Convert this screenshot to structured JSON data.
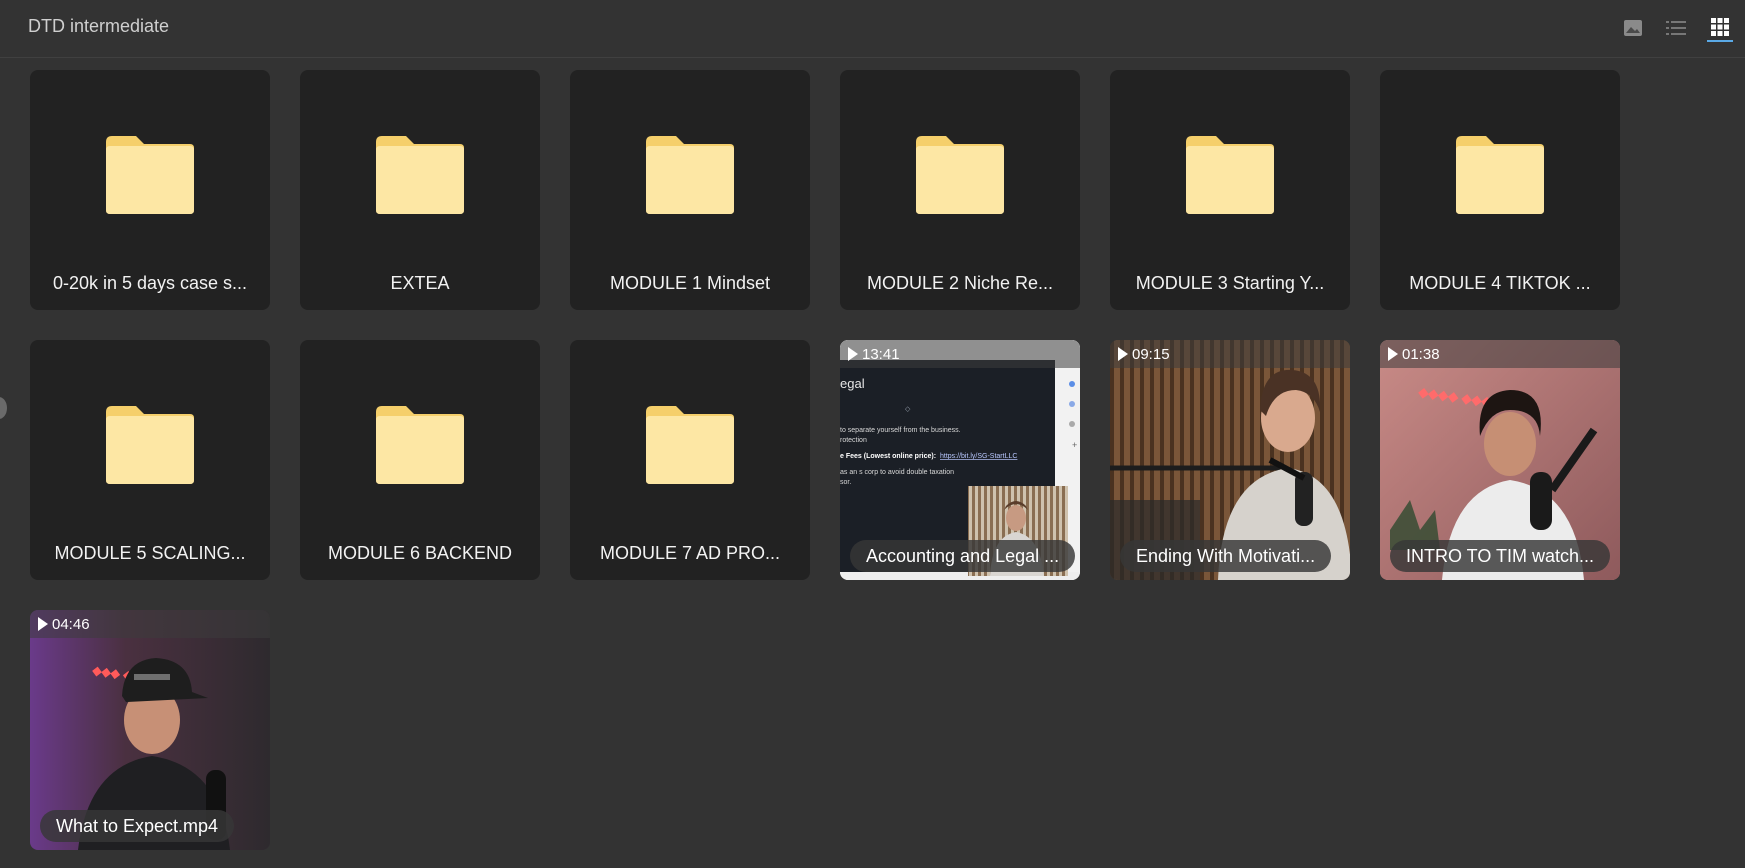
{
  "header": {
    "title": "DTD intermediate",
    "views": [
      {
        "name": "image-view",
        "icon": "image-icon"
      },
      {
        "name": "list-view",
        "icon": "list-icon"
      },
      {
        "name": "grid-view",
        "icon": "grid-icon",
        "active": true
      }
    ]
  },
  "folders": [
    {
      "label": "0-20k in 5 days case s..."
    },
    {
      "label": "EXTEA"
    },
    {
      "label": "MODULE 1 Mindset"
    },
    {
      "label": "MODULE 2 Niche Re..."
    },
    {
      "label": "MODULE 3 Starting Y..."
    },
    {
      "label": "MODULE 4 TIKTOK ..."
    },
    {
      "label": "MODULE 5 SCALING..."
    },
    {
      "label": "MODULE 6 BACKEND"
    },
    {
      "label": "MODULE 7 AD PRO..."
    }
  ],
  "videos": [
    {
      "label": "Accounting and Legal ...",
      "duration": "13:41"
    },
    {
      "label": "Ending With Motivati...",
      "duration": "09:15"
    },
    {
      "label": "INTRO TO TIM watch...",
      "duration": "01:38"
    },
    {
      "label": "What to Expect.mp4",
      "duration": "04:46"
    }
  ],
  "thumbnail_text": {
    "heading": "egal",
    "line1": "to separate yourself from the business.",
    "line2": "rotection",
    "line3_bold": "e Fees (Lowest online price):",
    "line3_link": "https://bit.ly/SG-StartLLC",
    "line4": "as an s corp to avoid double taxation",
    "line5": "sor."
  },
  "colors": {
    "background": "#333333",
    "tile": "#222222",
    "folder": "#fde7a4",
    "folder_tab": "#f5cf6b",
    "accent": "#5aa9e6"
  }
}
